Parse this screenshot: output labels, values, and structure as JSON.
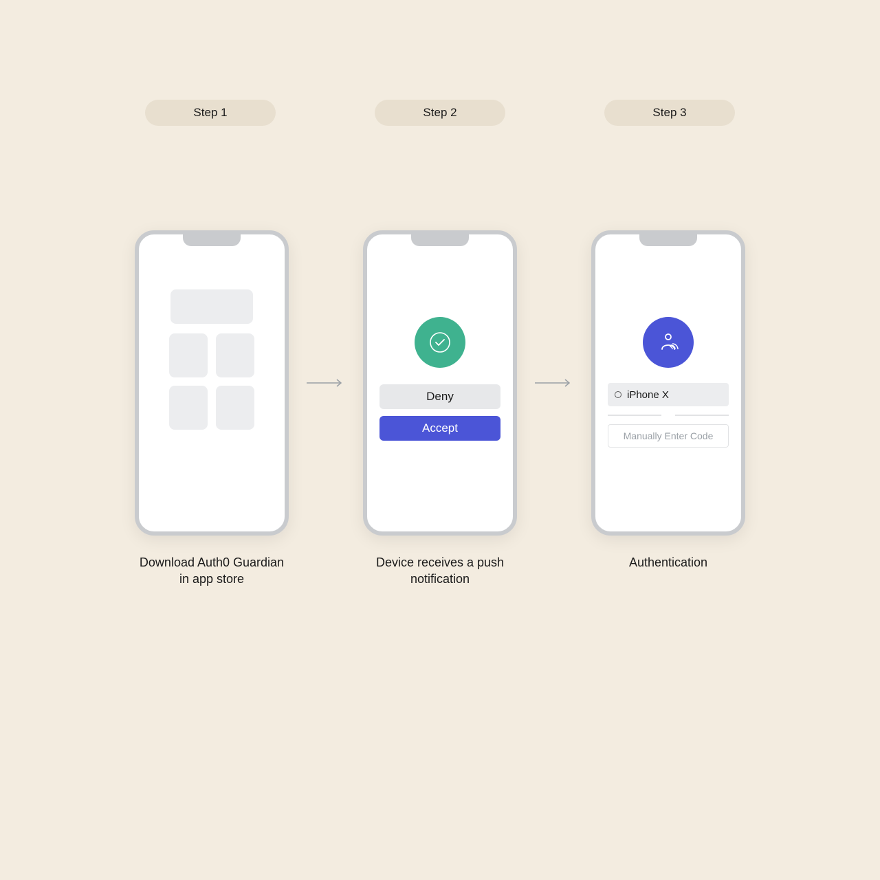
{
  "steps": {
    "labels": [
      "Step 1",
      "Step 2",
      "Step 3"
    ],
    "captions": [
      "Download Auth0 Guardian in app store",
      "Device receives a push notification",
      "Authentication"
    ]
  },
  "step2": {
    "deny_label": "Deny",
    "accept_label": "Accept"
  },
  "step3": {
    "device_name": "iPhone X",
    "manual_label": "Manually Enter Code"
  },
  "colors": {
    "background": "#f3ece0",
    "pill": "#e8dfcf",
    "phone_border": "#c9cbce",
    "placeholder": "#ecedef",
    "green": "#3fb28f",
    "blue": "#4b55d7"
  },
  "icons": {
    "check": "check-circle-icon",
    "user_fingerprint": "user-fingerprint-icon",
    "arrow": "arrow-right-icon",
    "radio": "radio-unchecked-icon"
  }
}
